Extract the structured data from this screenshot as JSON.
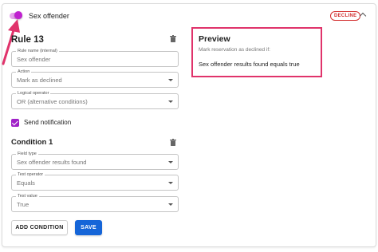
{
  "header": {
    "rule_name": "Sex offender",
    "badge": "DECLINE"
  },
  "rule": {
    "title": "Rule 13",
    "name_field": {
      "label": "Rule name (internal)",
      "value": "Sex offender"
    },
    "action_field": {
      "label": "Action",
      "value": "Mark as declined"
    },
    "operator_field": {
      "label": "Logical operator",
      "value": "OR (alternative conditions)"
    },
    "send_notification": {
      "label": "Send notification",
      "checked": true
    }
  },
  "condition": {
    "title": "Condition 1",
    "field_type": {
      "label": "Field type",
      "value": "Sex offender results found"
    },
    "test_operator": {
      "label": "Test operator",
      "value": "Equals"
    },
    "test_value": {
      "label": "Test value",
      "value": "True"
    }
  },
  "buttons": {
    "add_condition": "ADD CONDITION",
    "save": "SAVE"
  },
  "preview": {
    "title": "Preview",
    "subtitle": "Mark reservation as declined if:",
    "result": "Sex offender results found equals true"
  },
  "colors": {
    "accent_purple": "#a021c8",
    "decline_red": "#d32f2f",
    "primary_blue": "#1565d8",
    "highlight_pink": "#e0336b"
  },
  "icons": [
    "toggle-switch",
    "chevron-up-icon",
    "trash-icon",
    "dropdown-caret-icon",
    "annotation-arrow"
  ]
}
